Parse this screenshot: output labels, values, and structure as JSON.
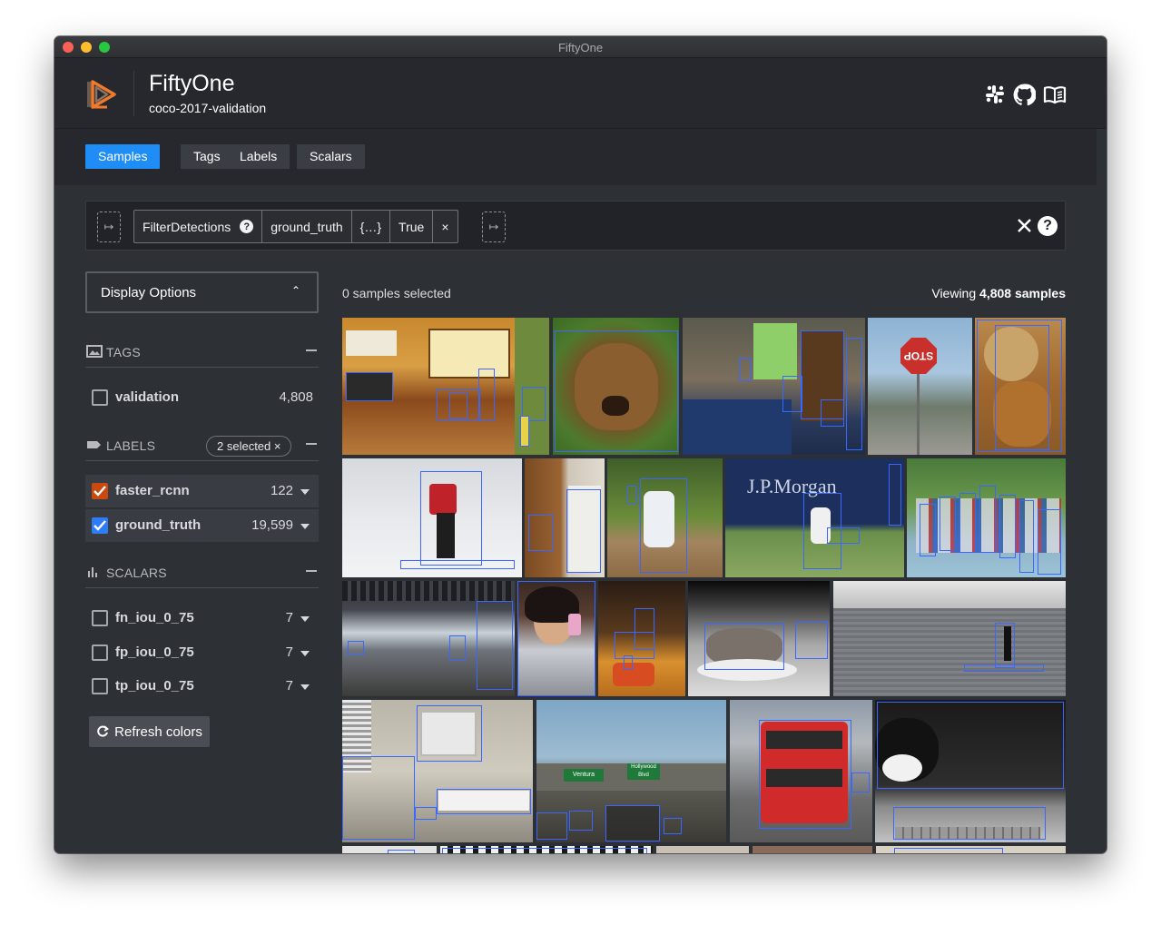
{
  "window": {
    "title": "FiftyOne"
  },
  "header": {
    "app_name": "FiftyOne",
    "dataset_name": "coco-2017-validation",
    "icons": [
      "slack-icon",
      "github-icon",
      "docs-book-icon"
    ]
  },
  "tabs": [
    {
      "label": "Samples",
      "active": true
    },
    {
      "label": "Tags",
      "active": false
    },
    {
      "label": "Labels",
      "active": false
    },
    {
      "label": "Scalars",
      "active": false
    }
  ],
  "view_bar": {
    "stage_name": "FilterDetections",
    "field": "ground_truth",
    "filter_symbol": "{…}",
    "value": "True"
  },
  "sidebar": {
    "display_options_label": "Display Options",
    "tags": {
      "title": "TAGS",
      "items": [
        {
          "name": "validation",
          "count": "4,808",
          "checked": false
        }
      ]
    },
    "labels": {
      "title": "LABELS",
      "selected_pill": "2 selected ×",
      "items": [
        {
          "name": "faster_rcnn",
          "count": "122",
          "checked": true,
          "color": "#c9490f"
        },
        {
          "name": "ground_truth",
          "count": "19,599",
          "checked": true,
          "color": "#2f7df6"
        }
      ]
    },
    "scalars": {
      "title": "SCALARS",
      "items": [
        {
          "name": "fn_iou_0_75",
          "count": "7",
          "checked": false
        },
        {
          "name": "fp_iou_0_75",
          "count": "7",
          "checked": false
        },
        {
          "name": "tp_iou_0_75",
          "count": "7",
          "checked": false
        }
      ]
    },
    "refresh_label": "Refresh colors"
  },
  "grid": {
    "selected_text": "0 samples selected",
    "viewing_prefix": "Viewing",
    "viewing_count": "4,808 samples"
  },
  "image_text": {
    "stop_sign": "STOP",
    "banner": "J.P.Morgan",
    "bus_sign": "Ventura",
    "bus_sign2": "Hollywood Blvd"
  },
  "colors": {
    "accent": "#1f8df5",
    "box": "#3a67ff",
    "faster_rcnn": "#c9490f",
    "ground_truth": "#2f7df6"
  }
}
